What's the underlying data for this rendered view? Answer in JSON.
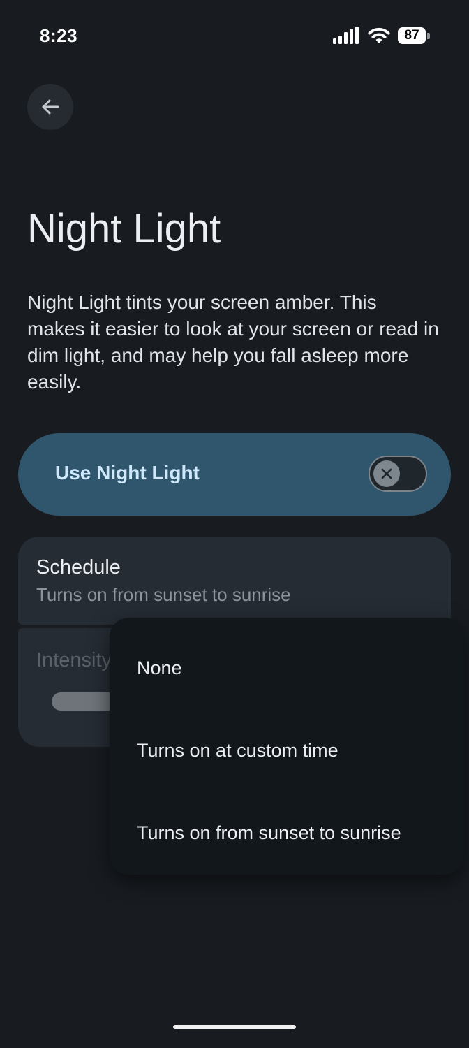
{
  "status_bar": {
    "time": "8:23",
    "battery_level": "87",
    "signal_icon": "signal-bars-icon",
    "wifi_icon": "wifi-icon"
  },
  "nav": {
    "back_icon": "arrow-back-icon"
  },
  "page": {
    "title": "Night Light",
    "description": "Night Light tints your screen amber. This makes it easier to look at your screen or read in dim light, and may help you fall asleep more easily."
  },
  "master_toggle": {
    "label": "Use Night Light",
    "state": "off",
    "thumb_icon": "close-icon"
  },
  "schedule": {
    "title": "Schedule",
    "value": "Turns on from sunset to sunrise"
  },
  "intensity": {
    "title": "Intensity"
  },
  "schedule_menu": {
    "options": [
      "None",
      "Turns on at custom time",
      "Turns on from sunset to sunrise"
    ]
  },
  "colors": {
    "background": "#181c21",
    "master_card": "#30566d",
    "card": "#262c34",
    "menu": "#12171b",
    "accent_text": "#cfe8fb"
  }
}
